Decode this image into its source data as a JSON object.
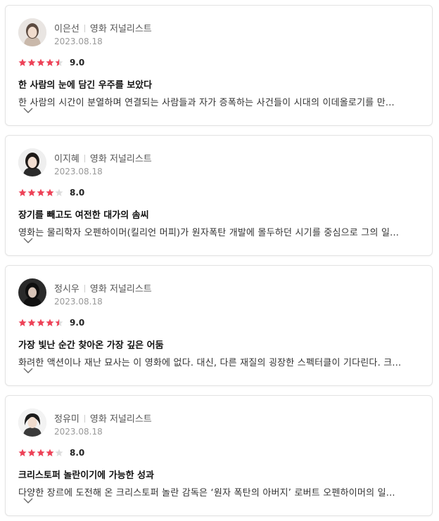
{
  "reviews": [
    {
      "avatar": "avatar-female-light-hair",
      "name": "이은선",
      "role": "영화 저널리스트",
      "date": "2023.08.18",
      "stars": 4.5,
      "score": "9.0",
      "headline": "한 사람의 눈에 담긴 우주를 보았다",
      "body": "한 사람의 시간이 분열하며 연결되는 사람들과 자가 증폭하는 사건들이 시대의 이데올로기를 만..."
    },
    {
      "avatar": "avatar-female-dark-hair",
      "name": "이지혜",
      "role": "영화 저널리스트",
      "date": "2023.08.18",
      "stars": 4,
      "score": "8.0",
      "headline": "장기를 빼고도 여전한 대가의 솜씨",
      "body": "영화는 물리학자 오펜하이머(킬리언 머피)가 원자폭탄 개발에 몰두하던 시기를 중심으로 그의 일..."
    },
    {
      "avatar": "avatar-female-black-hair",
      "name": "정시우",
      "role": "영화 저널리스트",
      "date": "2023.08.18",
      "stars": 4.5,
      "score": "9.0",
      "headline": "가장 빛난 순간 찾아온 가장 깊은 어둠",
      "body": "화려한 액션이나 재난 묘사는 이 영화에 없다. 대신, 다른 재질의 굉장한 스펙터클이 기다린다. 크..."
    },
    {
      "avatar": "avatar-female-short-hair",
      "name": "정유미",
      "role": "영화 저널리스트",
      "date": "2023.08.18",
      "stars": 4,
      "score": "8.0",
      "headline": "크리스토퍼 놀란이기에 가능한 성과",
      "body": "다양한 장르에 도전해 온 크리스토퍼 놀란 감독은 ‘원자 폭탄의 아버지’ 로버트 오펜하이머의 일..."
    }
  ],
  "colors": {
    "star_active": "#ee4157",
    "star_inactive": "#dddddd",
    "border": "#e3e3e3"
  },
  "icons": {
    "expand": "chevron-down-icon",
    "star": "star-icon"
  }
}
